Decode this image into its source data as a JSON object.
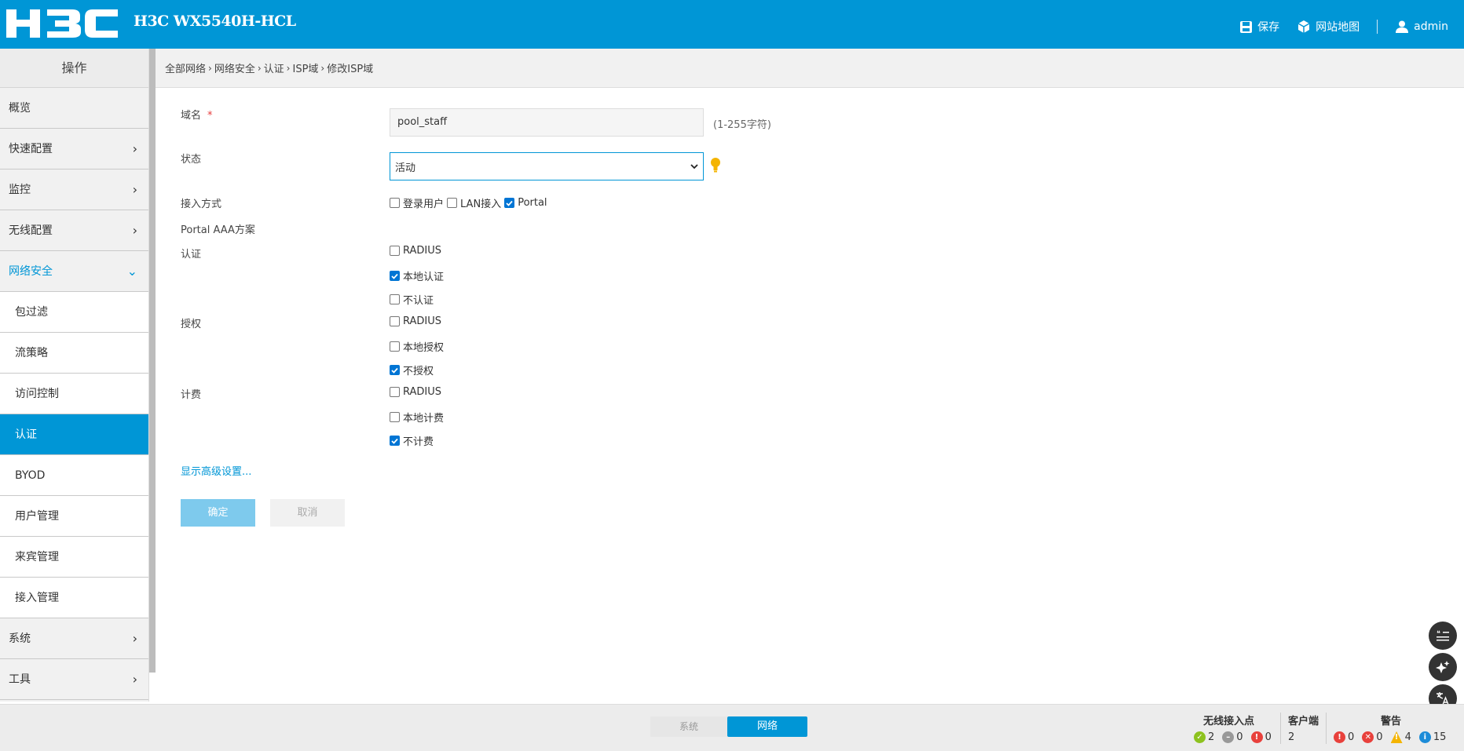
{
  "header": {
    "logo_text": "H3C",
    "device_name": "H3C WX5540H-HCL",
    "save_label": "保存",
    "sitemap_label": "网站地图",
    "user_label": "admin"
  },
  "sidebar": {
    "title": "操作",
    "items": [
      {
        "label": "概览",
        "chevron": ""
      },
      {
        "label": "快速配置",
        "chevron": "›"
      },
      {
        "label": "监控",
        "chevron": "›"
      },
      {
        "label": "无线配置",
        "chevron": "›"
      },
      {
        "label": "网络安全",
        "chevron": "⌄"
      },
      {
        "label": "包过滤"
      },
      {
        "label": "流策略"
      },
      {
        "label": "访问控制"
      },
      {
        "label": "认证"
      },
      {
        "label": "BYOD"
      },
      {
        "label": "用户管理"
      },
      {
        "label": "来宾管理"
      },
      {
        "label": "接入管理"
      },
      {
        "label": "系统",
        "chevron": "›"
      },
      {
        "label": "工具",
        "chevron": "›"
      }
    ]
  },
  "breadcrumb": [
    "全部网络",
    "网络安全",
    "认证",
    "ISP域",
    "修改ISP域"
  ],
  "breadcrumb_sep": "›",
  "form": {
    "domain_label": "域名",
    "required_mark": "*",
    "domain_value": "pool_staff",
    "domain_hint": "(1-255字符)",
    "state_label": "状态",
    "state_value": "活动",
    "access_label": "接入方式",
    "access_options": [
      {
        "label": "登录用户",
        "checked": false
      },
      {
        "label": "LAN接入",
        "checked": false
      },
      {
        "label": "Portal",
        "checked": true
      }
    ],
    "portal_aaa_label": "Portal AAA方案",
    "auth_label": "认证",
    "auth_options": [
      {
        "label": "RADIUS",
        "checked": false
      },
      {
        "label": "本地认证",
        "checked": true
      },
      {
        "label": "不认证",
        "checked": false
      }
    ],
    "authz_label": "授权",
    "authz_options": [
      {
        "label": "RADIUS",
        "checked": false
      },
      {
        "label": "本地授权",
        "checked": false
      },
      {
        "label": "不授权",
        "checked": true
      }
    ],
    "acct_label": "计费",
    "acct_options": [
      {
        "label": "RADIUS",
        "checked": false
      },
      {
        "label": "本地计费",
        "checked": false
      },
      {
        "label": "不计费",
        "checked": true
      }
    ],
    "advanced_link": "显示高级设置...",
    "ok_label": "确定",
    "cancel_label": "取消"
  },
  "footer": {
    "tab_system": "系统",
    "tab_network": "网络",
    "ap_title": "无线接入点",
    "ap_ok": "2",
    "ap_idle": "0",
    "ap_err": "0",
    "client_title": "客户端",
    "client_count": "2",
    "alarm_title": "警告",
    "alarm_critical": "0",
    "alarm_major": "0",
    "alarm_warning": "4",
    "alarm_info": "15"
  },
  "colors": {
    "accent": "#0096d6",
    "ok_button": "#7ecaed"
  }
}
